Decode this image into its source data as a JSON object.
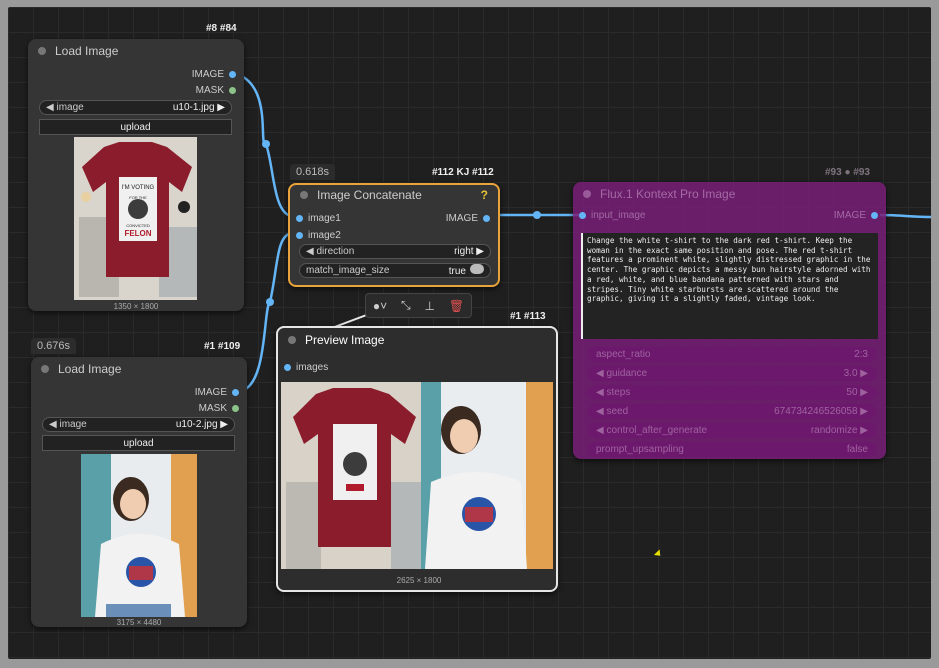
{
  "nodes": {
    "load1": {
      "badge": "#8 #84",
      "title": "Load Image",
      "outputs": [
        "IMAGE",
        "MASK"
      ],
      "image_widget": {
        "label": "image",
        "value": "u10-1.jpg"
      },
      "upload_label": "upload",
      "image_size": "1350 × 1800",
      "tshirt_text": [
        "I'M VOTING",
        "FOR THE",
        "CONVICTED",
        "FELON"
      ]
    },
    "load2": {
      "time": "0.676s",
      "badge": "#1 #109",
      "title": "Load Image",
      "outputs": [
        "IMAGE",
        "MASK"
      ],
      "image_widget": {
        "label": "image",
        "value": "u10-2.jpg"
      },
      "upload_label": "upload",
      "image_size": "3175 × 4480"
    },
    "concat": {
      "time": "0.618s",
      "badge": "#112 KJ #112",
      "title": "Image Concatenate",
      "help": "?",
      "inputs": [
        "image1",
        "image2"
      ],
      "output": "IMAGE",
      "direction": {
        "label": "direction",
        "value": "right"
      },
      "match": {
        "label": "match_image_size",
        "value": "true"
      }
    },
    "preview": {
      "badge": "#1 #113",
      "title": "Preview Image",
      "input": "images",
      "image_size": "2625 × 1800"
    },
    "kontext": {
      "badge": "#93 ● #93",
      "title": "Flux.1 Kontext Pro Image",
      "input": "input_image",
      "output": "IMAGE",
      "prompt": "Change the white t-shirt to the dark red t-shirt. Keep the woman in the exact same position and pose. The red t-shirt features a prominent white, slightly distressed graphic in the center. The graphic depicts a messy bun hairstyle adorned with a red, white, and blue bandana patterned with stars and stripes. Tiny white starbursts are scattered around the graphic, giving it a slightly faded, vintage look.",
      "widgets": [
        {
          "label": "aspect_ratio",
          "value": "2:3"
        },
        {
          "label": "guidance",
          "value": "3.0"
        },
        {
          "label": "steps",
          "value": "50"
        },
        {
          "label": "seed",
          "value": "674734246526058"
        },
        {
          "label": "control_after_generate",
          "value": "randomize"
        },
        {
          "label": "prompt_upsampling",
          "value": "false"
        }
      ]
    }
  },
  "colors": {
    "wire": "#64b5f6",
    "concat_outline": "#e8a33a",
    "kontext_bg": "#6e1f6e",
    "shirt_red": "#8b1c2c"
  },
  "toolbar_icons": [
    "color-circle-icon",
    "bypass-icon",
    "pin-icon",
    "delete-icon"
  ]
}
